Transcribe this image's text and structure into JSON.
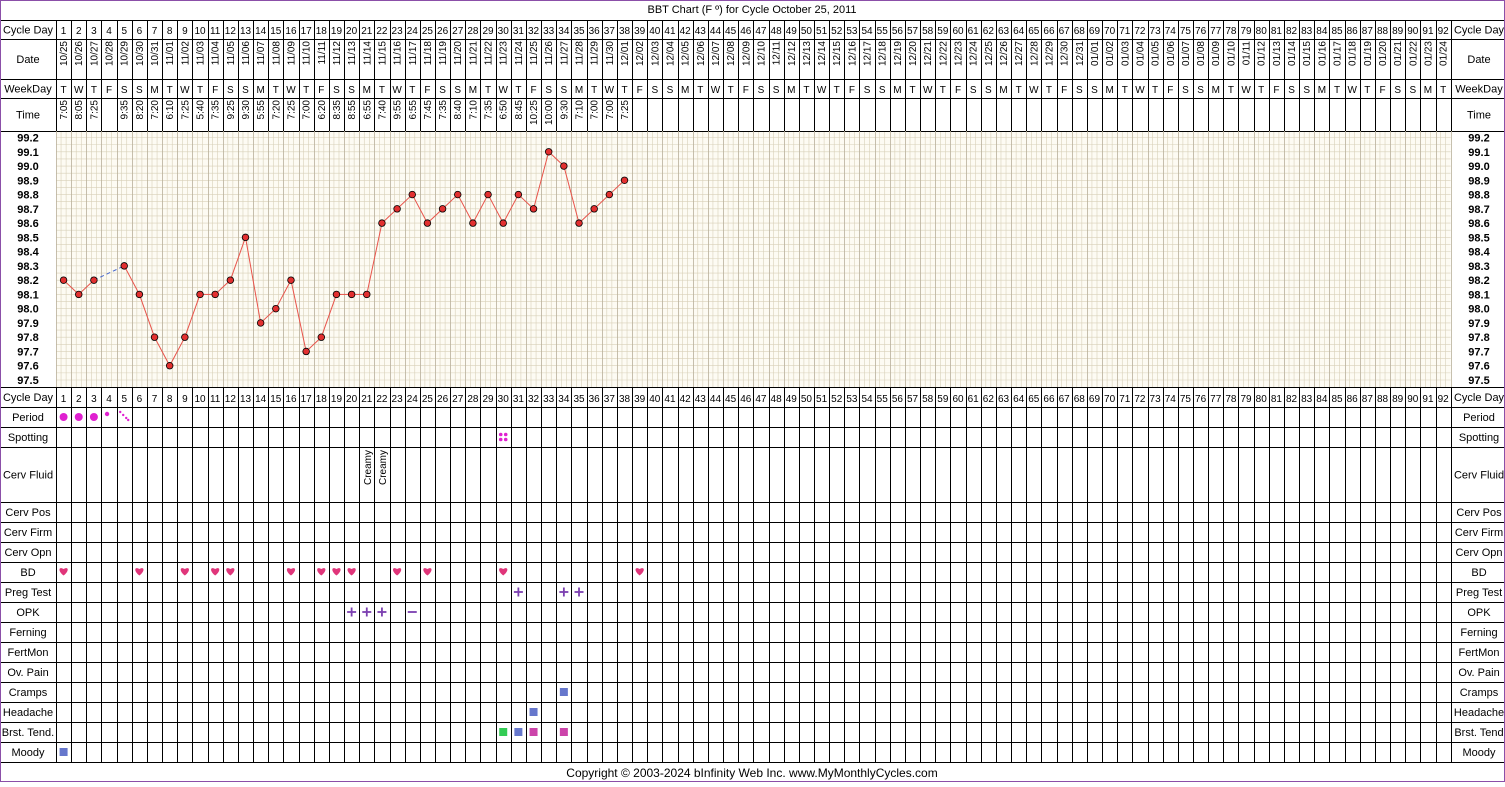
{
  "title": "BBT Chart (F º) for Cycle October 25, 2011",
  "footer": "Copyright © 2003-2024 bInfinity Web Inc.      www.MyMonthlyCycles.com",
  "colors": {
    "border": "#8b4fa8",
    "line": "#e8534a",
    "grid_minor": "#d8d0b8",
    "plot_bg": "#fdfbf3",
    "period": "#e020d0",
    "heart": "#e0357a",
    "plus": "#7b3fb0",
    "symptom_blue": "#6677cc",
    "symptom_green": "#33cc55",
    "symptom_pink": "#cc44aa"
  },
  "row_labels": {
    "cycle_day": "Cycle Day",
    "date": "Date",
    "weekday": "WeekDay",
    "time": "Time",
    "period": "Period",
    "spotting": "Spotting",
    "cerv_fluid": "Cerv Fluid",
    "cerv_pos": "Cerv Pos",
    "cerv_firm": "Cerv Firm",
    "cerv_opn": "Cerv Opn",
    "bd": "BD",
    "preg_test": "Preg Test",
    "opk": "OPK",
    "ferning": "Ferning",
    "fertmon": "FertMon",
    "ov_pain": "Ov. Pain",
    "cramps": "Cramps",
    "headache": "Headache",
    "brst_tend_left": "Brst. Tend.",
    "brst_tend_right": "Brst. Tend",
    "moody": "Moody"
  },
  "dates": [
    "10/25",
    "10/26",
    "10/27",
    "10/28",
    "10/29",
    "10/30",
    "10/31",
    "11/01",
    "11/02",
    "11/03",
    "11/04",
    "11/05",
    "11/06",
    "11/07",
    "11/08",
    "11/09",
    "11/10",
    "11/11",
    "11/12",
    "11/13",
    "11/14",
    "11/15",
    "11/16",
    "11/17",
    "11/18",
    "11/19",
    "11/20",
    "11/21",
    "11/22",
    "11/23",
    "11/24",
    "11/25",
    "11/26",
    "11/27",
    "11/28",
    "11/29",
    "11/30",
    "12/01",
    "12/02",
    "12/03",
    "12/04",
    "12/05",
    "12/06",
    "12/07",
    "12/08",
    "12/09",
    "12/10",
    "12/11",
    "12/12",
    "12/13",
    "12/14",
    "12/15",
    "12/16",
    "12/17",
    "12/18",
    "12/19",
    "12/20",
    "12/21",
    "12/22",
    "12/23",
    "12/24",
    "12/25",
    "12/26",
    "12/27",
    "12/28",
    "12/29",
    "12/30",
    "12/31",
    "01/01",
    "01/02",
    "01/03",
    "01/04",
    "01/05",
    "01/06",
    "01/07",
    "01/08",
    "01/09",
    "01/10",
    "01/11",
    "01/12",
    "01/13",
    "01/14",
    "01/15",
    "01/16",
    "01/17",
    "01/18",
    "01/19",
    "01/20",
    "01/21",
    "01/22",
    "01/23",
    "01/24"
  ],
  "weekdays": [
    "T",
    "W",
    "T",
    "F",
    "S",
    "S",
    "M",
    "T",
    "W",
    "T",
    "F",
    "S",
    "S",
    "M",
    "T",
    "W",
    "T",
    "F",
    "S",
    "S",
    "M",
    "T",
    "W",
    "T",
    "F",
    "S",
    "S",
    "M",
    "T",
    "W",
    "T",
    "F",
    "S",
    "S",
    "M",
    "T",
    "W",
    "T",
    "F",
    "S",
    "S",
    "M",
    "T",
    "W",
    "T",
    "F",
    "S",
    "S",
    "M",
    "T",
    "W",
    "T",
    "F",
    "S",
    "S",
    "M",
    "T",
    "W",
    "T",
    "F",
    "S",
    "S",
    "M",
    "T",
    "W",
    "T",
    "F",
    "S",
    "S",
    "M",
    "T",
    "W",
    "T",
    "F",
    "S",
    "S",
    "M",
    "T",
    "W",
    "T",
    "F",
    "S",
    "S",
    "M",
    "T",
    "W",
    "T",
    "F",
    "S",
    "S",
    "M",
    "T"
  ],
  "times": [
    "7:05",
    "8:05",
    "7:25",
    "",
    "9:35",
    "8:20",
    "7:20",
    "6:10",
    "7:25",
    "5:40",
    "7:35",
    "9:25",
    "9:30",
    "5:55",
    "7:20",
    "7:25",
    "7:00",
    "6:20",
    "8:35",
    "8:55",
    "6:55",
    "7:40",
    "9:55",
    "6:55",
    "7:45",
    "7:35",
    "8:40",
    "7:10",
    "7:35",
    "6:50",
    "8:45",
    "10:25",
    "10:00",
    "9:30",
    "7:10",
    "7:00",
    "7:00",
    "7:25"
  ],
  "chart_data": {
    "type": "line",
    "title": "BBT Chart (F º) for Cycle October 25, 2011",
    "xlabel": "Cycle Day",
    "ylabel": "",
    "x": [
      1,
      2,
      3,
      4,
      5,
      6,
      7,
      8,
      9,
      10,
      11,
      12,
      13,
      14,
      15,
      16,
      17,
      18,
      19,
      20,
      21,
      22,
      23,
      24,
      25,
      26,
      27,
      28,
      29,
      30,
      31,
      32,
      33,
      34,
      35,
      36,
      37,
      38,
      39,
      40,
      41,
      42,
      43,
      44,
      45,
      46,
      47,
      48,
      49,
      50,
      51,
      52,
      53,
      54,
      55,
      56,
      57,
      58,
      59,
      60,
      61,
      62,
      63,
      64,
      65,
      66,
      67,
      68,
      69,
      70,
      71,
      72,
      73,
      74,
      75,
      76,
      77,
      78,
      79,
      80,
      81,
      82,
      83,
      84,
      85,
      86,
      87,
      88,
      89,
      90,
      91,
      92
    ],
    "ylim": [
      97.5,
      99.2
    ],
    "yticks": [
      "97.5",
      "97.6",
      "97.7",
      "97.8",
      "97.9",
      "98.0",
      "98.1",
      "98.2",
      "98.3",
      "98.4",
      "98.5",
      "98.6",
      "98.7",
      "98.8",
      "98.9",
      "99.0",
      "99.1",
      "99.2"
    ],
    "grid": true,
    "series": [
      {
        "values": [
          98.2,
          98.1,
          98.2,
          null,
          98.3,
          98.1,
          97.8,
          97.6,
          97.8,
          98.1,
          98.1,
          98.2,
          98.5,
          97.9,
          98.0,
          98.2,
          97.7,
          97.8,
          98.1,
          98.1,
          98.1,
          98.6,
          98.7,
          98.8,
          98.6,
          98.7,
          98.8,
          98.6,
          98.8,
          98.6,
          98.8,
          98.7,
          99.1,
          99.0,
          98.6,
          98.7,
          98.8,
          98.9
        ]
      }
    ]
  },
  "observations": {
    "period": [
      {
        "day": 1,
        "mark": "dot"
      },
      {
        "day": 2,
        "mark": "dot"
      },
      {
        "day": 3,
        "mark": "dot"
      },
      {
        "day": 4,
        "mark": "small"
      },
      {
        "day": 5,
        "mark": "spot"
      }
    ],
    "spotting": [
      {
        "day": 30,
        "mark": "spots"
      }
    ],
    "cerv_fluid": [
      {
        "day": 21,
        "text": "Creamy"
      },
      {
        "day": 22,
        "text": "Creamy"
      }
    ],
    "bd": [
      1,
      6,
      9,
      11,
      12,
      16,
      18,
      19,
      20,
      23,
      25,
      30,
      39
    ],
    "preg_test": [
      {
        "day": 31,
        "mark": "+"
      },
      {
        "day": 34,
        "mark": "+"
      },
      {
        "day": 35,
        "mark": "+"
      }
    ],
    "opk": [
      {
        "day": 20,
        "mark": "+"
      },
      {
        "day": 21,
        "mark": "+"
      },
      {
        "day": 22,
        "mark": "+"
      },
      {
        "day": 24,
        "mark": "-"
      }
    ],
    "cramps": [
      {
        "day": 34,
        "color": "#6677cc"
      }
    ],
    "headache": [
      {
        "day": 32,
        "color": "#6677cc"
      }
    ],
    "brst_tend": [
      {
        "day": 30,
        "color": "#33cc55"
      },
      {
        "day": 31,
        "color": "#6677cc"
      },
      {
        "day": 32,
        "color": "#cc44aa"
      },
      {
        "day": 34,
        "color": "#cc44aa"
      }
    ],
    "moody": [
      {
        "day": 1,
        "color": "#6677cc"
      }
    ]
  }
}
